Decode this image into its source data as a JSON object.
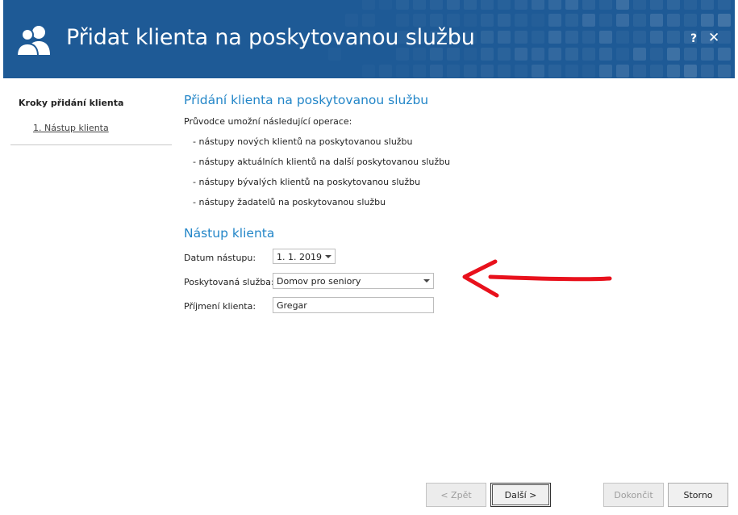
{
  "header": {
    "title": "Přidat klienta na poskytovanou službu",
    "help_label": "?",
    "close_label": "✕",
    "icon": "users-icon",
    "background_color": "#1e5a96"
  },
  "sidebar": {
    "title": "Kroky přidání klienta",
    "steps": [
      {
        "label": "1. Nástup klienta"
      }
    ]
  },
  "main": {
    "section1_title": "Přidání klienta na poskytovanou službu",
    "intro": "Průvodce umožní následující operace:",
    "operations": [
      "- nástupy nových klientů na poskytovanou službu",
      "- nástupy aktuálních klientů na další poskytovanou službu",
      "- nástupy bývalých klientů na poskytovanou službu",
      "- nástupy žadatelů na poskytovanou službu"
    ],
    "section2_title": "Nástup klienta",
    "form": {
      "date_label": "Datum nástupu:",
      "date_value": "1. 1. 2019",
      "service_label": "Poskytovaná služba:",
      "service_value": "Domov pro seniory",
      "surname_label": "Příjmení klienta:",
      "surname_value": "Gregar"
    },
    "accent_color": "#2386c8",
    "annotation_color": "#e8111c"
  },
  "footer": {
    "back_label": "< Zpět",
    "next_label": "Další >",
    "finish_label": "Dokončit",
    "cancel_label": "Storno"
  }
}
